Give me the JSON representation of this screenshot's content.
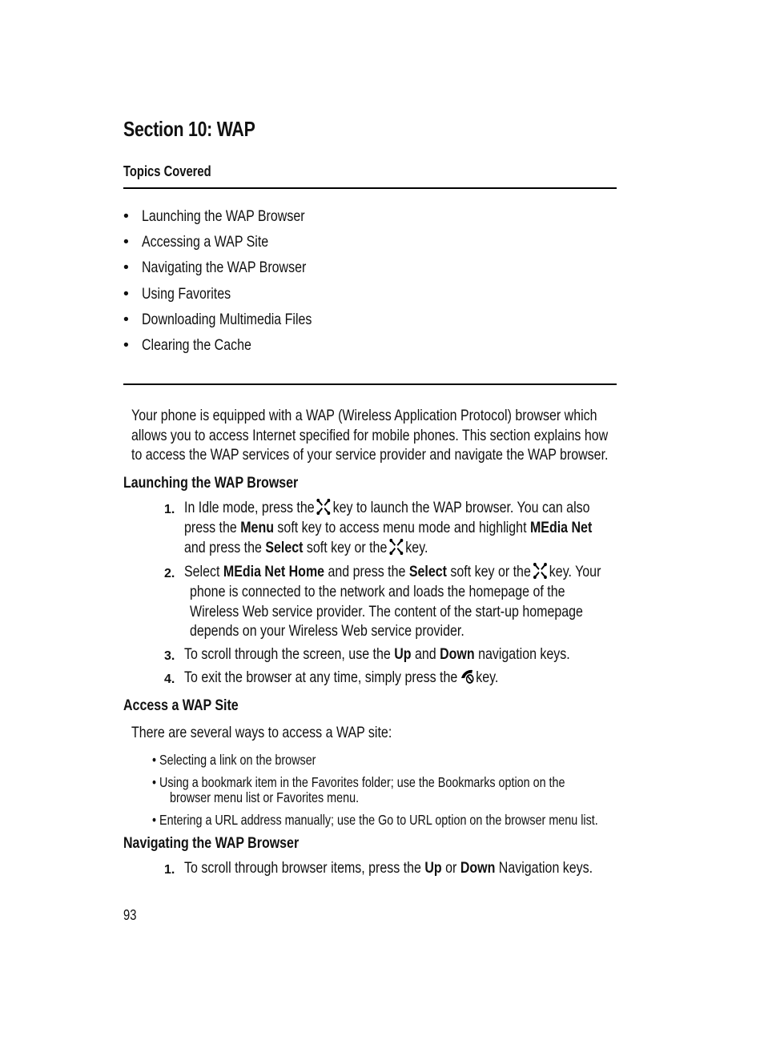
{
  "section_title": "Section 10: WAP",
  "topics": {
    "heading": "Topics Covered",
    "items": [
      "Launching the WAP Browser",
      "Accessing a WAP Site",
      "Navigating the WAP Browser",
      "Using Favorites",
      "Downloading Multimedia Files",
      "Clearing the Cache"
    ]
  },
  "intro": {
    "lines": [
      "Your phone is equipped with a WAP (Wireless Application Protocol) browser which",
      "allows you to access Internet specified for mobile phones. This section explains how",
      "to access the WAP services of your service provider and navigate the WAP browser."
    ]
  },
  "launching": {
    "heading": "Launching the WAP Browser",
    "steps": [
      {
        "num": "1.",
        "l1a": "In Idle mode, press the",
        "l1b": "key to launch the WAP browser. You can also",
        "l2a": "press the",
        "l2b": "Menu",
        "l2c": "soft key to access menu mode and highlight",
        "l2d": "MEdia Net",
        "l3a": "and press the",
        "l3b": "Select",
        "l3c": "soft key or the",
        "l3d": "key."
      },
      {
        "num": "2.",
        "l1a": "Select",
        "l1b": "MEdia Net Home",
        "l1c": "and press the",
        "l1d": "Select",
        "l1e": "soft key or the",
        "l1f": "key. Your",
        "l2": "phone is connected to the network and loads the homepage of the",
        "l3": "Wireless Web service provider. The content of the start-up homepage",
        "l4": "depends on your Wireless Web service provider."
      },
      {
        "num": "3.",
        "a": "To scroll through the screen, use the",
        "b": "Up",
        "c": "and",
        "d": "Down",
        "e": "navigation keys."
      },
      {
        "num": "4.",
        "a": "To exit the browser at any time, simply press the",
        "b": "key."
      }
    ]
  },
  "access": {
    "heading": "Access a WAP Site",
    "intro": "There are several ways to access a WAP site:",
    "bullets": [
      {
        "l1": "Selecting a link on the browser"
      },
      {
        "l1": "Using a bookmark item in the Favorites folder; use the Bookmarks option on the",
        "l2": "browser menu list or Favorites menu."
      },
      {
        "l1": "Entering a URL address manually; use the Go to URL option on the browser menu list."
      }
    ]
  },
  "navigating": {
    "heading": "Navigating the WAP Browser",
    "steps": [
      {
        "num": "1.",
        "a": "To scroll through browser items, press the",
        "b": "Up",
        "c": "or",
        "d": "Down",
        "e": "Navigation keys."
      }
    ]
  },
  "page_number": "93",
  "icons": {
    "web_key": "web-key-icon",
    "end_key": "end-key-icon"
  }
}
